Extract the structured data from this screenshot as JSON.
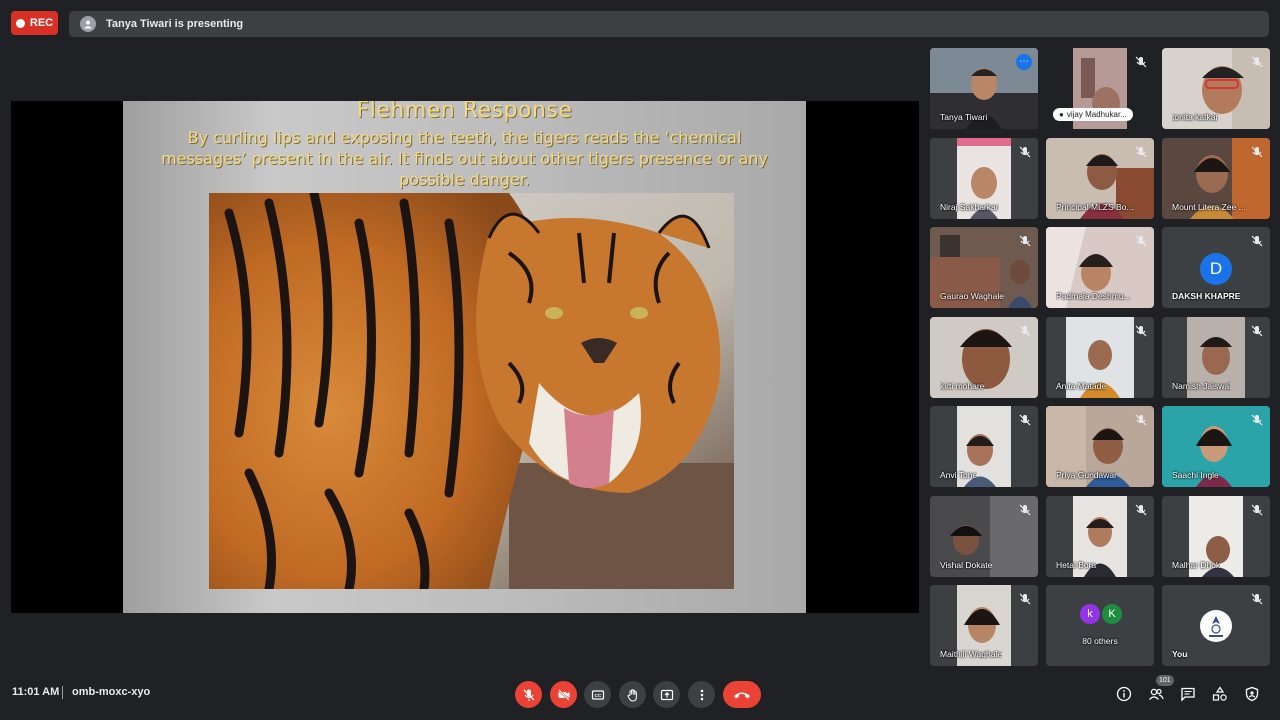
{
  "top": {
    "rec_label": "REC",
    "presenting_text": "Tanya Tiwari is presenting"
  },
  "slide": {
    "title": "Flehmen Response",
    "body": "By curling lips and exposing the teeth, the tigers reads the ‘chemical messages’ present in the air. It finds out about other tigers presence or any possible danger."
  },
  "participants": [
    {
      "name": "Tanya Tiwari"
    },
    {
      "name": "vijay Madhukar..."
    },
    {
      "name": "tonita katkar"
    },
    {
      "name": "Niraj Sakharkar"
    },
    {
      "name": "Principal MLZS Bo..."
    },
    {
      "name": "Mount Litera Zee ..."
    },
    {
      "name": "Gaurao Waghale"
    },
    {
      "name": "Padmaja Deshmu..."
    },
    {
      "name": "DAKSH KHAPRE",
      "initial": "D"
    },
    {
      "name": "kirti mohare"
    },
    {
      "name": "Anita Matade"
    },
    {
      "name": "Namish Jaiswal"
    },
    {
      "name": "Anvi Tone"
    },
    {
      "name": "Priya Gundawar"
    },
    {
      "name": "Saachi Ingle"
    },
    {
      "name": "Vishal Dokate"
    },
    {
      "name": "Hetal Bora"
    },
    {
      "name": "Malhar Dhok"
    },
    {
      "name": "Maithili Waghale"
    }
  ],
  "others": {
    "label": "80 others",
    "initials": [
      "k",
      "K"
    ]
  },
  "self_tile": {
    "label": "You"
  },
  "bottom": {
    "time": "11:01 AM",
    "meeting_code": "omb-moxc-xyo",
    "participant_count": "101"
  },
  "colors": {
    "accent_blue": "#1a73e8",
    "danger_red": "#ea4335",
    "rec_red": "#d93025",
    "bar_grey": "#3c4043",
    "background": "#202124",
    "slide_text_gold": "#f1d98a"
  },
  "icons": {
    "mic": "microphone-off-icon",
    "camera": "camera-off-icon",
    "captions": "closed-captions-icon",
    "hand": "raise-hand-icon",
    "present": "present-screen-icon",
    "more": "more-options-icon",
    "end": "end-call-icon",
    "info": "info-icon",
    "people": "people-icon",
    "chat": "chat-icon",
    "activities": "activities-icon",
    "host": "host-controls-icon"
  }
}
